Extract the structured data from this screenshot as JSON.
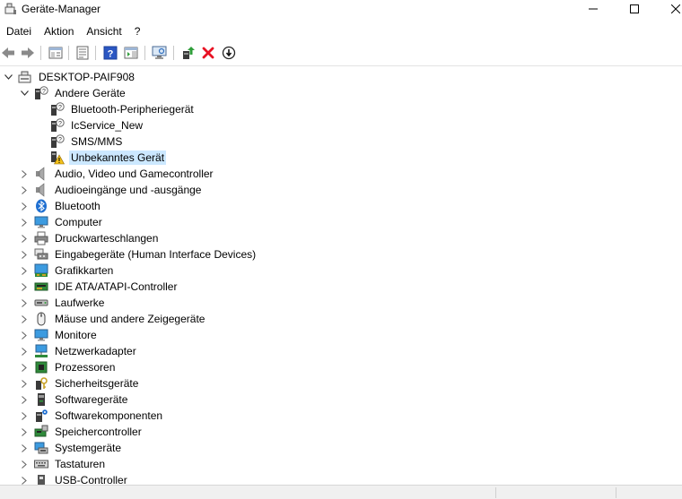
{
  "window": {
    "title": "Geräte-Manager",
    "minimize_icon": "minimize-icon",
    "maximize_icon": "maximize-icon",
    "close_icon": "close-icon"
  },
  "menu": {
    "items": [
      "Datei",
      "Aktion",
      "Ansicht",
      "?"
    ]
  },
  "toolbar": {
    "buttons": [
      "back-arrow-icon",
      "forward-arrow-icon",
      "show-hide-console-tree-icon",
      "properties-icon",
      "help-icon",
      "action-pane-icon",
      "scan-hardware-icon",
      "update-driver-icon",
      "uninstall-device-icon",
      "disable-device-icon"
    ]
  },
  "tree": {
    "root": {
      "label": "DESKTOP-PAIF908",
      "icon": "computer-icon",
      "expanded": true
    },
    "other_devices": {
      "label": "Andere Geräte",
      "icon": "unknown-device-icon",
      "expanded": true,
      "children": [
        {
          "label": "Bluetooth-Peripheriegerät",
          "icon": "unknown-device-icon"
        },
        {
          "label": "IcService_New",
          "icon": "unknown-device-icon"
        },
        {
          "label": "SMS/MMS",
          "icon": "unknown-device-icon"
        },
        {
          "label": "Unbekanntes Gerät",
          "icon": "warning-device-icon",
          "selected": true
        }
      ]
    },
    "categories": [
      {
        "label": "Audio, Video und Gamecontroller",
        "icon": "speaker-icon"
      },
      {
        "label": "Audioeingänge und -ausgänge",
        "icon": "speaker-icon"
      },
      {
        "label": "Bluetooth",
        "icon": "bluetooth-icon"
      },
      {
        "label": "Computer",
        "icon": "monitor-icon"
      },
      {
        "label": "Druckwarteschlangen",
        "icon": "printer-icon"
      },
      {
        "label": "Eingabegeräte (Human Interface Devices)",
        "icon": "hid-icon"
      },
      {
        "label": "Grafikkarten",
        "icon": "display-adapter-icon"
      },
      {
        "label": "IDE ATA/ATAPI-Controller",
        "icon": "ide-controller-icon"
      },
      {
        "label": "Laufwerke",
        "icon": "disk-drive-icon"
      },
      {
        "label": "Mäuse und andere Zeigegeräte",
        "icon": "mouse-icon"
      },
      {
        "label": "Monitore",
        "icon": "monitor-icon"
      },
      {
        "label": "Netzwerkadapter",
        "icon": "network-adapter-icon"
      },
      {
        "label": "Prozessoren",
        "icon": "processor-icon"
      },
      {
        "label": "Sicherheitsgeräte",
        "icon": "security-device-icon"
      },
      {
        "label": "Softwaregeräte",
        "icon": "software-device-icon"
      },
      {
        "label": "Softwarekomponenten",
        "icon": "software-component-icon"
      },
      {
        "label": "Speichercontroller",
        "icon": "storage-controller-icon"
      },
      {
        "label": "Systemgeräte",
        "icon": "system-device-icon"
      },
      {
        "label": "Tastaturen",
        "icon": "keyboard-icon"
      },
      {
        "label": "USB-Controller",
        "icon": "usb-controller-icon"
      }
    ]
  },
  "colors": {
    "selection": "#cce8ff",
    "back_forward_arrow": "#8a8a8a",
    "help_blue": "#2b57c3",
    "uninstall_red": "#e81123",
    "scan_green": "#2f9e3a"
  }
}
